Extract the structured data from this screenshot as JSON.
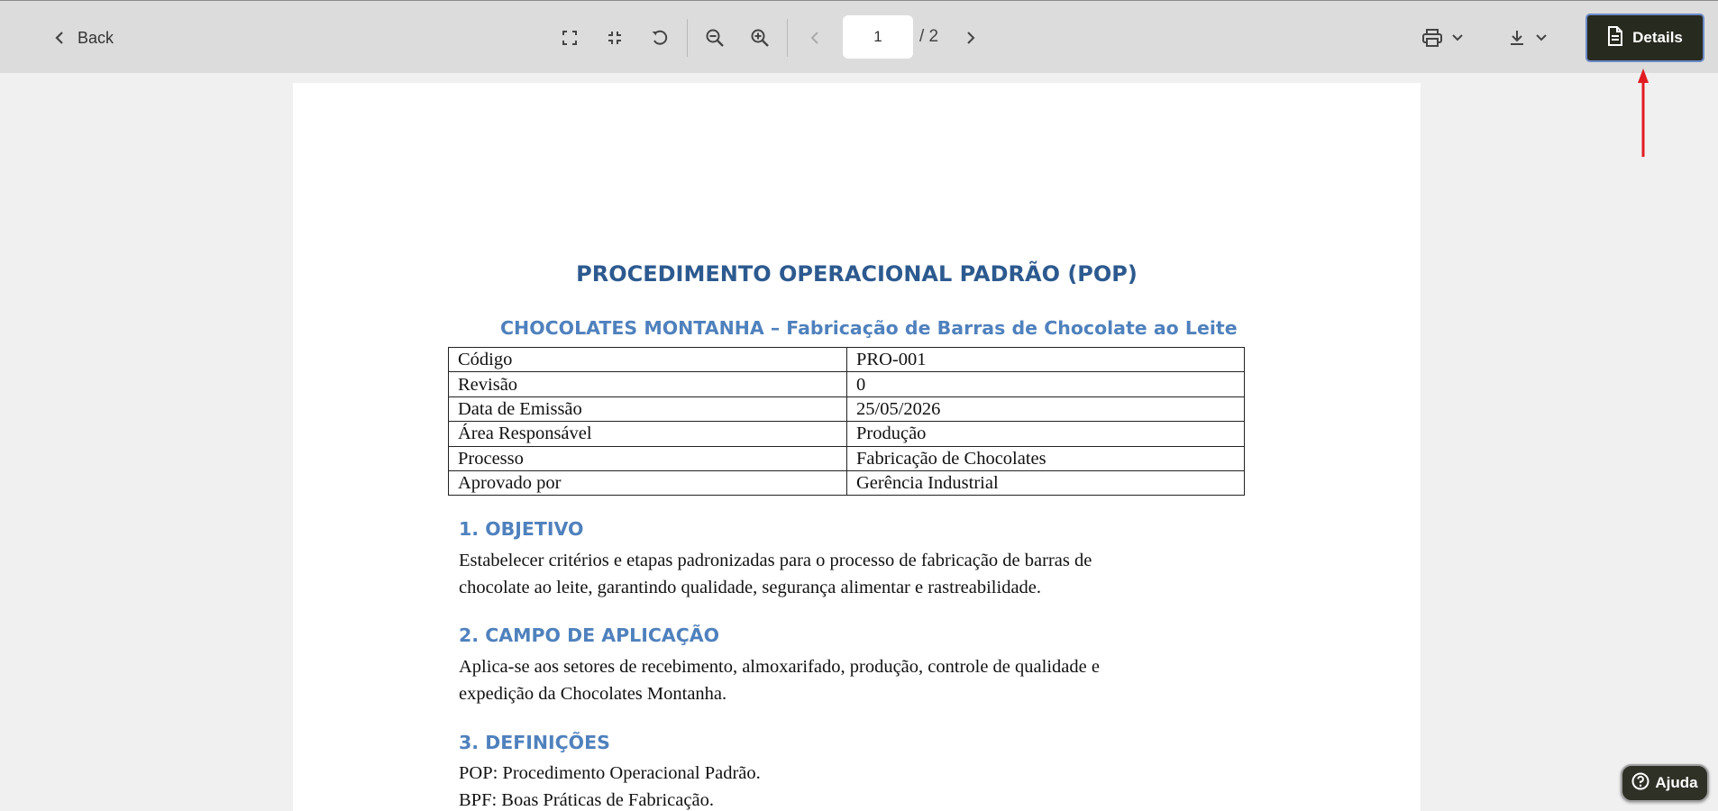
{
  "toolbar": {
    "back_label": "Back",
    "page_current": "1",
    "page_total": "/ 2",
    "details_label": "Details",
    "icons": [
      "fullscreen-icon",
      "fit-page-icon",
      "rotate-icon",
      "zoom-out-icon",
      "zoom-in-icon",
      "prev-page-icon",
      "next-page-icon",
      "print-icon",
      "chevron-down-icon",
      "download-icon",
      "chevron-down-icon",
      "document-icon"
    ]
  },
  "annotation": {
    "arrow_color": "#e11b22"
  },
  "document": {
    "title": "PROCEDIMENTO OPERACIONAL PADRÃO (POP)",
    "subtitle": "CHOCOLATES MONTANHA – Fabricação de Barras de Chocolate ao Leite",
    "meta_rows": [
      {
        "key": "Código",
        "value": "PRO-001"
      },
      {
        "key": "Revisão",
        "value": "0"
      },
      {
        "key": "Data de Emissão",
        "value": "25/05/2026"
      },
      {
        "key": "Área Responsável",
        "value": "Produção"
      },
      {
        "key": "Processo",
        "value": "Fabricação de Chocolates"
      },
      {
        "key": "Aprovado por",
        "value": "Gerência Industrial"
      }
    ],
    "sections": [
      {
        "heading": "1. OBJETIVO",
        "lines": [
          "Estabelecer critérios e etapas padronizadas para o processo de fabricação de barras de",
          "chocolate ao leite, garantindo qualidade, segurança alimentar e rastreabilidade."
        ]
      },
      {
        "heading": "2. CAMPO DE APLICAÇÃO",
        "lines": [
          "Aplica-se aos setores de recebimento, almoxarifado, produção, controle de qualidade e",
          "expedição da Chocolates Montanha."
        ]
      },
      {
        "heading": "3. DEFINIÇÕES",
        "lines": [
          "POP: Procedimento Operacional Padrão.",
          "BPF: Boas Práticas de Fabricação."
        ]
      }
    ]
  },
  "help": {
    "label": "Ajuda"
  },
  "colors": {
    "toolbar_bg": "#dcdcdc",
    "details_bg": "#272a1f",
    "heading_blue": "#4f81bd",
    "title_blue": "#2c5a8f"
  }
}
